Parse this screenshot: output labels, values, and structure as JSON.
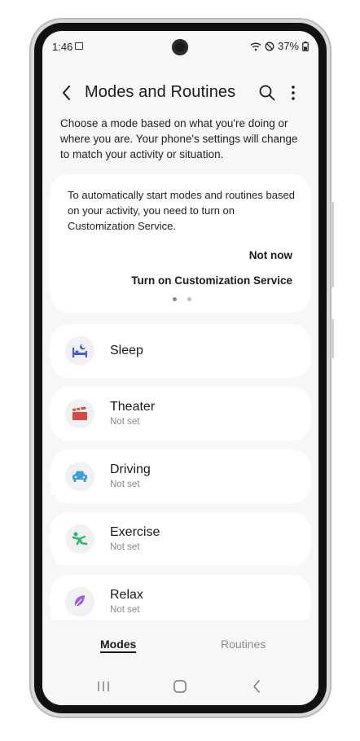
{
  "status_bar": {
    "time": "1:46",
    "battery": "37%",
    "icons": [
      "gallery-icon",
      "wifi-icon",
      "dnd-icon",
      "battery-icon"
    ]
  },
  "header": {
    "title": "Modes and Routines",
    "icons": [
      "back-icon",
      "search-icon",
      "more-options-icon"
    ]
  },
  "description": "Choose a mode based on what you're doing or where you are. Your phone's settings will change to match your activity or situation.",
  "promo_card": {
    "text": "To automatically start modes and routines based on your activity, you need to turn on Customization Service.",
    "not_now_label": "Not now",
    "turn_on_label": "Turn on Customization Service",
    "page_count": 2,
    "active_page": 1
  },
  "modes": [
    {
      "name": "Sleep",
      "status": "",
      "icon": "bed-icon",
      "color": "#4b5fc9"
    },
    {
      "name": "Theater",
      "status": "Not set",
      "icon": "clapperboard-icon",
      "color": "#d34c43"
    },
    {
      "name": "Driving",
      "status": "Not set",
      "icon": "car-icon",
      "color": "#3aa0d8"
    },
    {
      "name": "Exercise",
      "status": "Not set",
      "icon": "running-icon",
      "color": "#27b86b"
    },
    {
      "name": "Relax",
      "status": "Not set",
      "icon": "leaf-icon",
      "color": "#9b5fe0"
    }
  ],
  "bottom_tabs": {
    "modes_label": "Modes",
    "routines_label": "Routines",
    "selected": "Modes"
  },
  "nav_bar": {
    "icons": [
      "recents-icon",
      "home-icon",
      "nav-back-icon"
    ]
  }
}
